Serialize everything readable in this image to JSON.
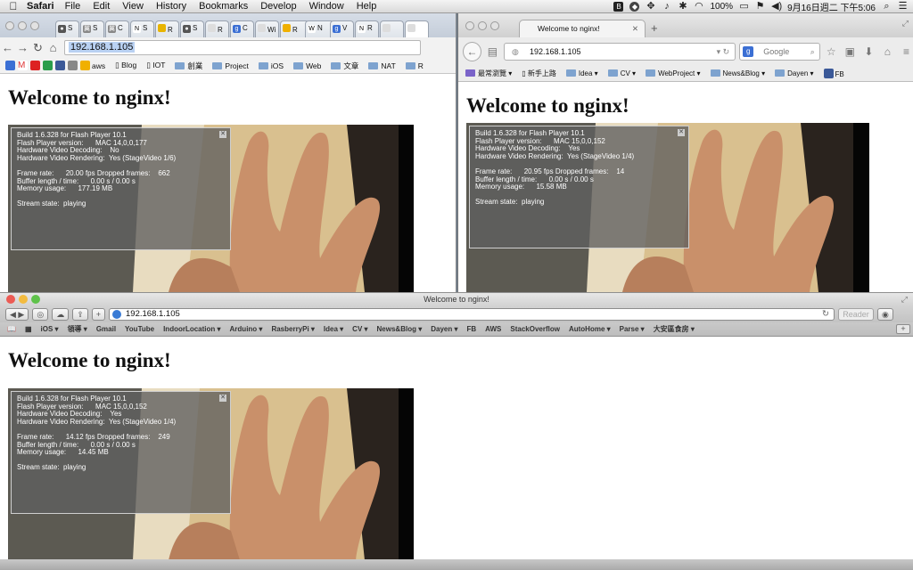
{
  "menubar": {
    "app_name": "Safari",
    "menus": [
      "File",
      "Edit",
      "View",
      "History",
      "Bookmarks",
      "Develop",
      "Window",
      "Help"
    ],
    "battery": "100%",
    "datetime": "9月16日週二 下午5:06"
  },
  "page": {
    "heading": "Welcome to nginx!"
  },
  "chrome": {
    "tabs": [
      "S",
      "S",
      "C",
      "S",
      "R",
      "S",
      "R",
      "C",
      "Wi",
      "R",
      "N",
      "V",
      "R"
    ],
    "tab_icons": [
      "",
      "翼",
      "翼",
      "N",
      "",
      "",
      "",
      "g",
      "",
      "",
      "g",
      "N",
      ""
    ],
    "url": "192.168.1.105",
    "bookmarks": [
      "aws",
      "Blog",
      "IOT",
      "創業",
      "Project",
      "iOS",
      "Web",
      "文章",
      "NAT",
      "R"
    ],
    "flash": {
      "build": "Build 1.6.328 for Flash Player 10.1",
      "player_version_label": "Flash Player version:",
      "player_version": "MAC 14,0,0,177",
      "hw_decoding_label": "Hardware Video Decoding:",
      "hw_decoding": "No",
      "hw_rendering_label": "Hardware Video Rendering:",
      "hw_rendering": "Yes (StageVideo 1/6)",
      "frame_rate_label": "Frame rate:",
      "frame_rate": "20.00 fps",
      "dropped_label": "Dropped frames:",
      "dropped": "662",
      "buffer_label": "Buffer length / time:",
      "buffer": "0.00 s / 0.00 s",
      "memory_label": "Memory usage:",
      "memory": "177.19 MB",
      "stream_label": "Stream state:",
      "stream": "playing"
    }
  },
  "firefox": {
    "tab_title": "Welcome to nginx!",
    "url": "192.168.1.105",
    "search_placeholder": "Google",
    "bookmarks": [
      "最常瀏覽",
      "新手上路",
      "Idea",
      "CV",
      "WebProject",
      "News&Blog",
      "Dayen",
      "FB"
    ],
    "flash": {
      "build": "Build 1.6.328 for Flash Player 10.1",
      "player_version_label": "Flash Player version:",
      "player_version": "MAC 15,0,0,152",
      "hw_decoding_label": "Hardware Video Decoding:",
      "hw_decoding": "Yes",
      "hw_rendering_label": "Hardware Video Rendering:",
      "hw_rendering": "Yes (StageVideo 1/4)",
      "frame_rate_label": "Frame rate:",
      "frame_rate": "20.95 fps",
      "dropped_label": "Dropped frames:",
      "dropped": "14",
      "buffer_label": "Buffer length / time:",
      "buffer": "0.00 s / 0.00 s",
      "memory_label": "Memory usage:",
      "memory": "15.58 MB",
      "stream_label": "Stream state:",
      "stream": "playing"
    }
  },
  "safari": {
    "window_title": "Welcome to nginx!",
    "url": "192.168.1.105",
    "reader_label": "Reader",
    "bookmarks": [
      "iOS ▾",
      "領導 ▾",
      "Gmail",
      "YouTube",
      "IndoorLocation ▾",
      "Arduino ▾",
      "RasberryPi ▾",
      "Idea ▾",
      "CV ▾",
      "News&Blog ▾",
      "Dayen ▾",
      "FB",
      "AWS",
      "StackOverflow",
      "AutoHome ▾",
      "Parse ▾",
      "大安區食房 ▾"
    ],
    "flash": {
      "build": "Build 1.6.328 for Flash Player 10.1",
      "player_version_label": "Flash Player version:",
      "player_version": "MAC 15,0,0,152",
      "hw_decoding_label": "Hardware Video Decoding:",
      "hw_decoding": "Yes",
      "hw_rendering_label": "Hardware Video Rendering:",
      "hw_rendering": "Yes (StageVideo 1/4)",
      "frame_rate_label": "Frame rate:",
      "frame_rate": "14.12 fps",
      "dropped_label": "Dropped frames:",
      "dropped": "249",
      "buffer_label": "Buffer length / time:",
      "buffer": "0.00 s / 0.00 s",
      "memory_label": "Memory usage:",
      "memory": "14.45 MB",
      "stream_label": "Stream state:",
      "stream": "playing"
    }
  }
}
